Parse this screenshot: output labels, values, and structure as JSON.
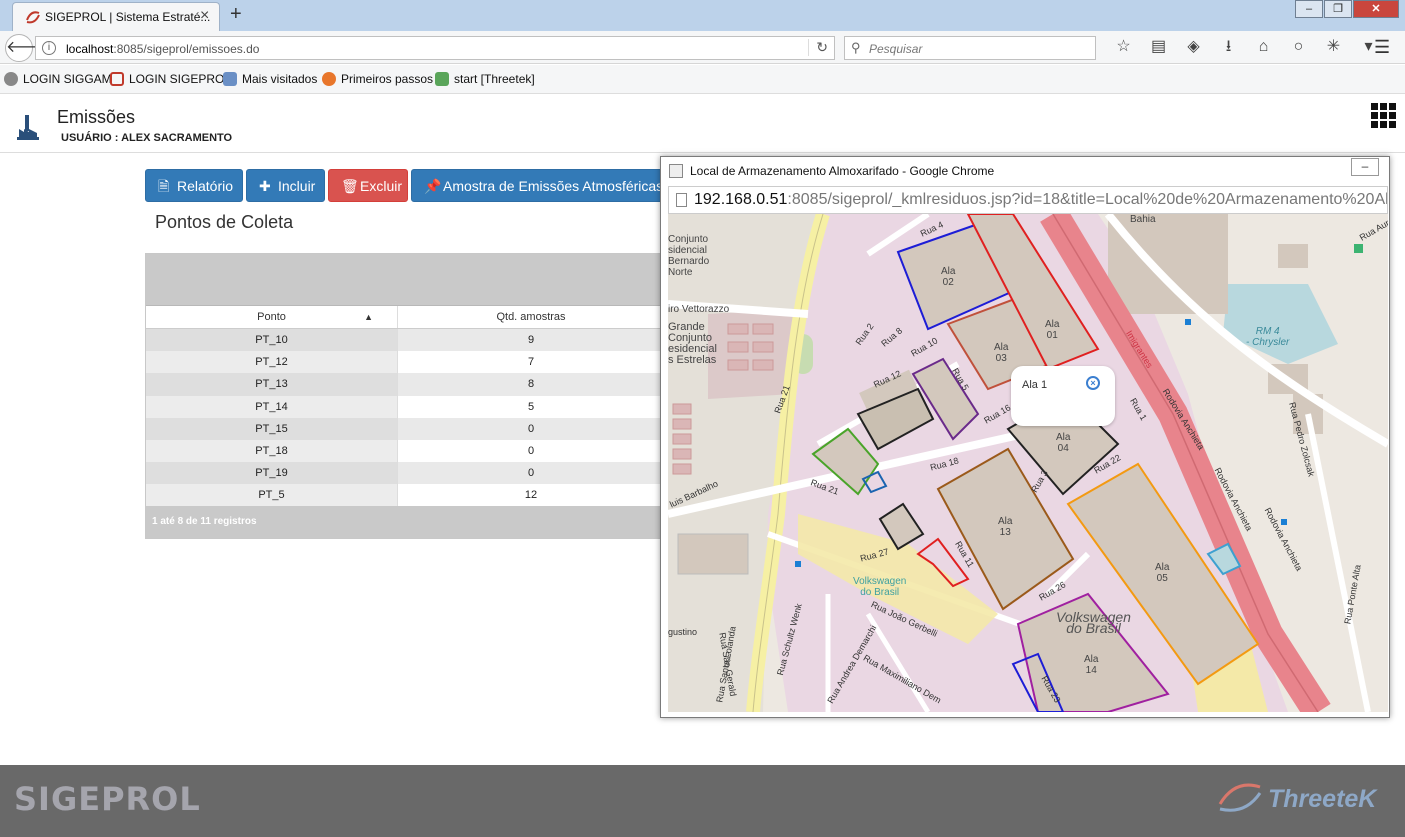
{
  "browser": {
    "tab_title": "SIGEPROL | Sistema Estraté...",
    "url_host": "localhost",
    "url_rest": ":8085/sigeprol/emissoes.do",
    "search_placeholder": "Pesquisar",
    "bookmarks": [
      "LOGIN SIGGAM",
      "LOGIN SIGEPROL",
      "Mais visitados",
      "Primeiros passos",
      "start [Threetek]"
    ]
  },
  "app": {
    "title": "Emissões",
    "user": "USUÁRIO : ALEX SACRAMENTO"
  },
  "toolbar": {
    "relatorio": "Relatório",
    "incluir": "Incluir",
    "excluir": "Excluir",
    "amostra": "Amostra de Emissões Atmosféricas"
  },
  "section_title": "Pontos de Coleta",
  "table": {
    "col_ponto": "Ponto",
    "col_qtd": "Qtd. amostras",
    "rows": [
      {
        "ponto": "PT_10",
        "qtd": "9"
      },
      {
        "ponto": "PT_12",
        "qtd": "7"
      },
      {
        "ponto": "PT_13",
        "qtd": "8"
      },
      {
        "ponto": "PT_14",
        "qtd": "5"
      },
      {
        "ponto": "PT_15",
        "qtd": "0"
      },
      {
        "ponto": "PT_18",
        "qtd": "0"
      },
      {
        "ponto": "PT_19",
        "qtd": "0"
      },
      {
        "ponto": "PT_5",
        "qtd": "12"
      }
    ],
    "footer": "1 até 8 de 11 registros"
  },
  "popup": {
    "title": "Local de Armazenamento Almoxarifado - Google Chrome",
    "url_host": "192.168.0.51",
    "url_rest": ":8085/sigeprol/_kmlresiduos.jsp?id=18&title=Local%20de%20Armazenamento%20Alm",
    "infowindow": "Ala 1",
    "map_labels": {
      "ala02": "Ala\n02",
      "ala03": "Ala\n03",
      "ala04": "Ala\n04",
      "ala01": "Ala\n01",
      "ala13": "Ala\n13",
      "ala05": "Ala\n05",
      "ala14": "Ala\n14",
      "vw": "Volkswagen\ndo Brasil",
      "vw_small": "Volkswagen\ndo Brasil",
      "rm4": "RM 4\n- Chrysler",
      "bahia": "Bahia",
      "conjunto": "Conjunto\nsidencial\nBernardo\nNorte",
      "grande": "Grande\nConjunto\nesidencial\ns Estrelas",
      "vettorazzo": "iro Vettorazzo",
      "rodovia1": "Rodovia Anchieta",
      "rodovia2": "Rodovia Anchieta",
      "rodovia3": "Rodovia Anchieta",
      "rua4": "Rua 4",
      "rua2": "Rua 2",
      "rua8": "Rua 8",
      "rua10": "Rua 10",
      "rua12": "Rua 12",
      "rua5": "Rua 5",
      "rua16": "Rua 16",
      "rua18": "Rua 18",
      "rua22": "Rua 22",
      "rua21": "Rua 21",
      "rua27": "Rua 27",
      "rua26": "Rua 26",
      "rua11": "Rua 11",
      "rua3": "Rua 3",
      "rua1": "Rua 1",
      "rua23": "Rua 23",
      "ruajoao": "Rua João Gerbelli",
      "ruapedro": "Rua Pedro Zolcsak",
      "ruaponte": "Rua Ponte Alta",
      "ruasaog": "Rua São Gerald",
      "ruasanta": "Rua Santa Lolanda",
      "ruaschultz": "Rua Schultz Wenk",
      "ruaandrea": "Rua Andrea Demarchi",
      "ruamax": "Rua Maximiliano Dem",
      "ruaaure": "Rua Aure",
      "barbalho": "luis Barbalho",
      "agostino": "gustino",
      "imigrantes": "Imigrantes"
    }
  },
  "footer": {
    "left_logo": "SIGEPROL",
    "right_logo": "ThreeteK"
  },
  "colors": {
    "primary": "#337ab7",
    "danger": "#d9534f",
    "footer_bg": "#696969",
    "map_highway": "#e8848c"
  }
}
